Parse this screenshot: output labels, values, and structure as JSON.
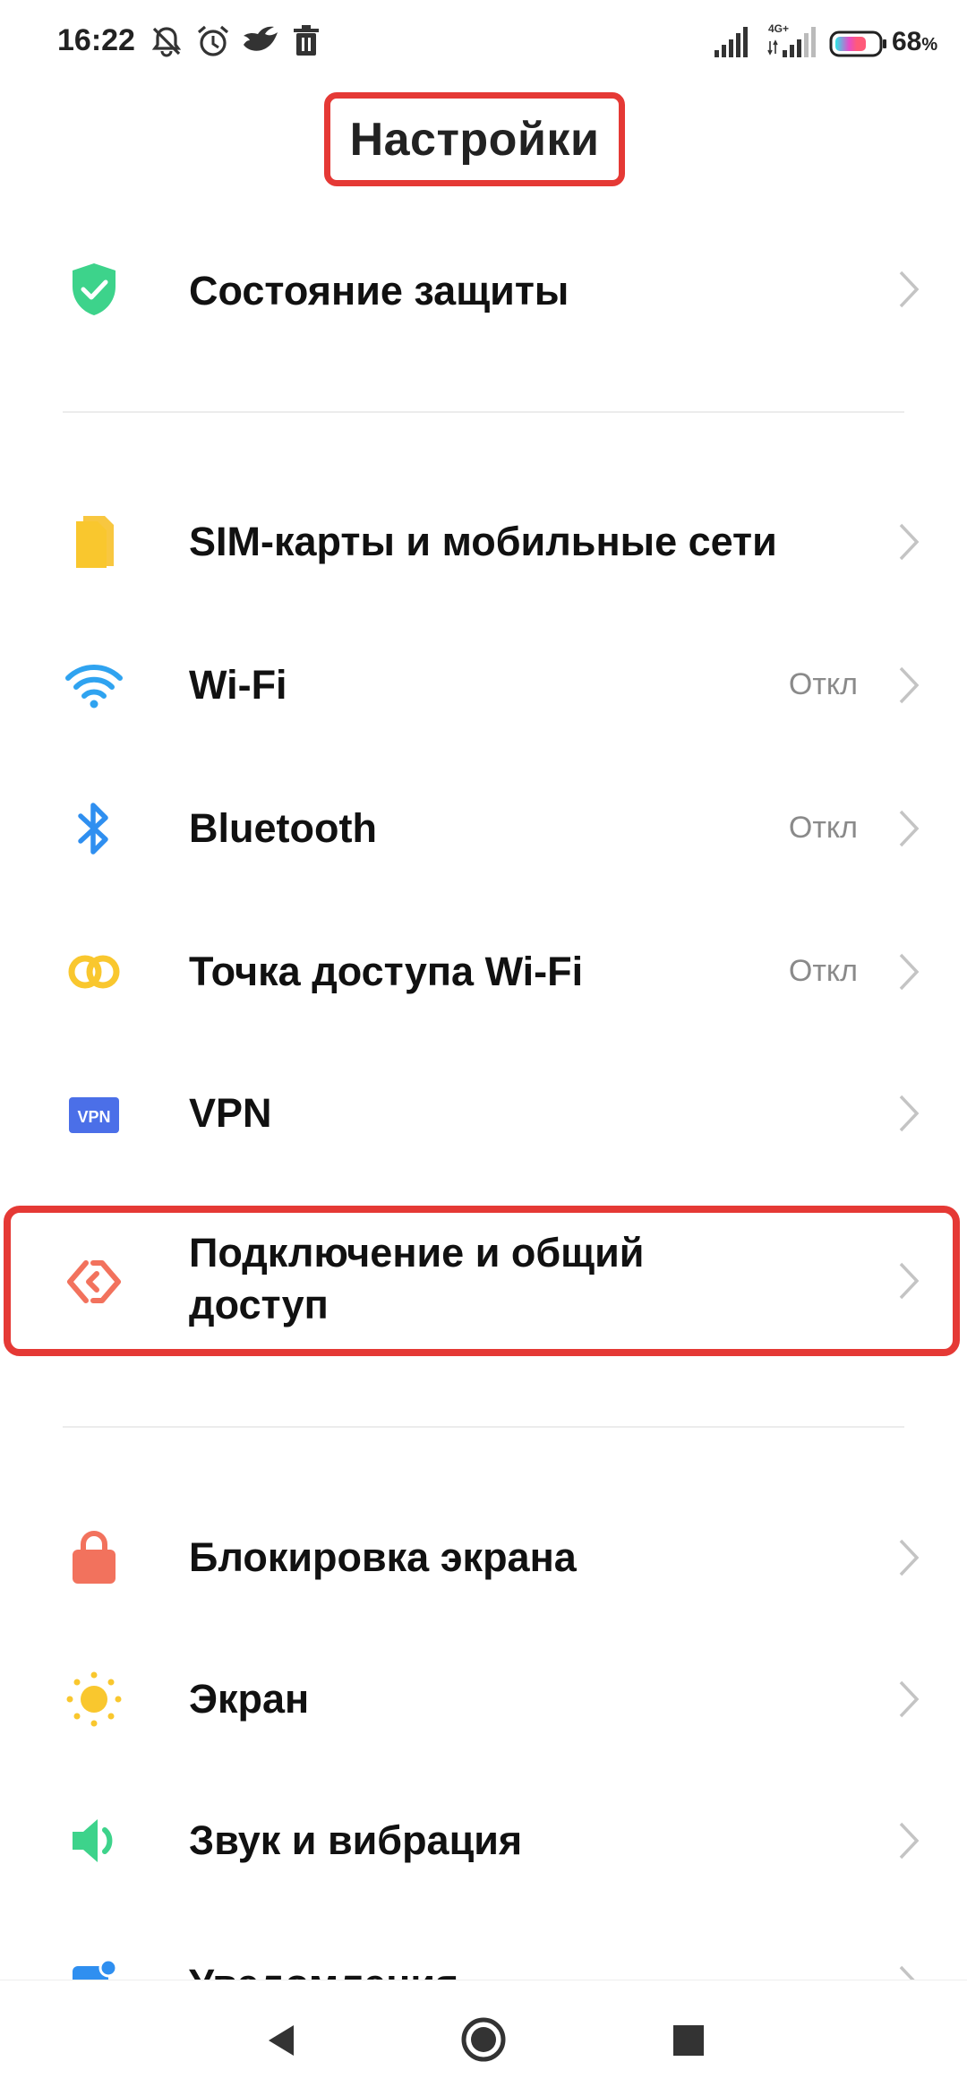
{
  "status_bar": {
    "time": "16:22",
    "icons": [
      "muted-alarm-icon",
      "alarm-clock-icon",
      "bird-icon",
      "trash-icon",
      "signal-icon",
      "signal-4g-icon",
      "battery-icon"
    ],
    "network_label": "4G+",
    "battery_percent": "68",
    "battery_percent_sign": "%"
  },
  "header": {
    "title": "Настройки"
  },
  "settings": [
    {
      "label": "Состояние защиты",
      "icon": "shield-check-icon",
      "color": "#3dd38b"
    },
    {
      "label": "SIM-карты и мобильные сети",
      "icon": "sim-card-icon",
      "color": "#f9c72e"
    },
    {
      "label": "Wi-Fi",
      "value": "Откл",
      "icon": "wifi-icon",
      "color": "#2fa3f0"
    },
    {
      "label": "Bluetooth",
      "value": "Откл",
      "icon": "bluetooth-icon",
      "color": "#2f8ff0"
    },
    {
      "label": "Точка доступа Wi-Fi",
      "value": "Откл",
      "icon": "hotspot-icon",
      "color": "#f9c72e"
    },
    {
      "label": "VPN",
      "icon": "vpn-icon",
      "color": "#4b6fe8",
      "icon_text": "VPN"
    },
    {
      "label": "Подключение и общий доступ",
      "label_line1": "Подключение и общий",
      "label_line2": "доступ",
      "icon": "connection-sharing-icon",
      "color": "#f2725d"
    },
    {
      "label": "Блокировка экрана",
      "icon": "lock-icon",
      "color": "#f2725d"
    },
    {
      "label": "Экран",
      "icon": "sun-icon",
      "color": "#f9c72e"
    },
    {
      "label": "Звук и вибрация",
      "icon": "speaker-icon",
      "color": "#3dd38b"
    },
    {
      "label": "Уведомления",
      "icon": "notification-icon",
      "color": "#2f8ff0"
    }
  ],
  "nav_bar": {
    "buttons": [
      "back-icon",
      "home-icon",
      "recents-icon"
    ]
  },
  "colors": {
    "highlight": "#e53935",
    "chevron": "#c4c4c4",
    "value_text": "#8a8a8a"
  }
}
